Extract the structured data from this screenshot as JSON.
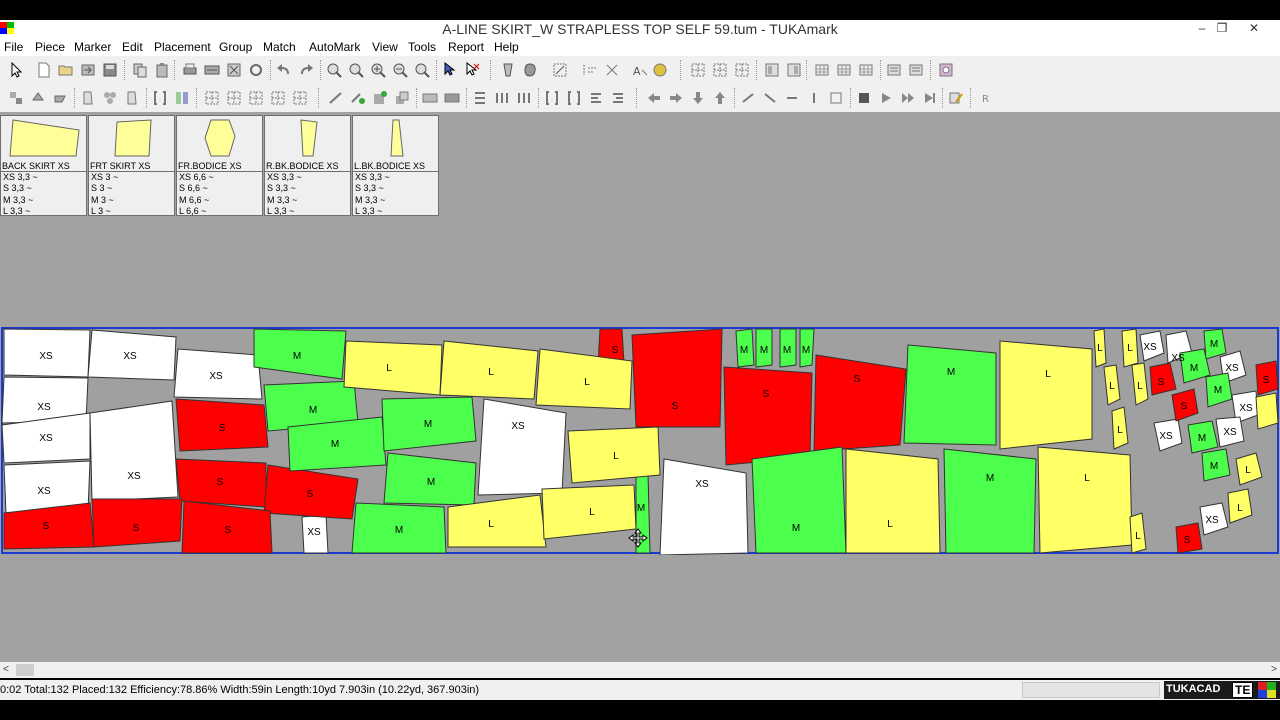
{
  "window": {
    "title": "A-LINE SKIRT_W STRAPLESS TOP SELF 59.tum - TUKAmark",
    "minimize_glyph": "–",
    "maximize_glyph": "❐",
    "close_glyph": "✕"
  },
  "menu": [
    "File",
    "Piece",
    "Marker",
    "Edit",
    "Placement",
    "Group",
    "Match",
    "AutoMark",
    "View",
    "Tools",
    "Report",
    "Help"
  ],
  "pieces": [
    {
      "name": "BACK SKIRT XS",
      "sizes": [
        "XS  3,3 ~",
        "S   3,3 ~",
        "M   3,3 ~",
        "L   3,3 ~"
      ]
    },
    {
      "name": "FRT SKIRT XS",
      "sizes": [
        "XS  3   ~",
        "S   3   ~",
        "M   3   ~",
        "L   3   ~"
      ]
    },
    {
      "name": "FR.BODICE XS",
      "sizes": [
        "XS  6,6 ~",
        "S   6,6 ~",
        "M   6,6 ~",
        "L   6,6 ~"
      ]
    },
    {
      "name": "R.BK.BODICE XS",
      "sizes": [
        "XS  3,3 ~",
        "S   3,3 ~",
        "M   3,3 ~",
        "L   3,3 ~"
      ]
    },
    {
      "name": "L.BK.BODICE XS",
      "sizes": [
        "XS  3,3 ~",
        "S   3,3 ~",
        "M   3,3 ~",
        "L   3,3 ~"
      ]
    }
  ],
  "size_colors": {
    "XS": "#ffffff",
    "S": "#ff0000",
    "M": "#4cff4c",
    "L": "#ffff66"
  },
  "marker_labels": [
    "XS",
    "XS",
    "XS",
    "XS",
    "XS",
    "XS",
    "XS",
    "XS",
    "XS",
    "XS",
    "XS",
    "XS",
    "XS",
    "XS",
    "XS",
    "XS",
    "XS",
    "S",
    "S",
    "S",
    "S",
    "S",
    "S",
    "S",
    "S",
    "S",
    "S",
    "S",
    "S",
    "S",
    "S",
    "M",
    "M",
    "M",
    "M",
    "M",
    "M",
    "M",
    "M",
    "M",
    "M",
    "M",
    "M",
    "M",
    "M",
    "M",
    "M",
    "M",
    "M",
    "M",
    "L",
    "L",
    "L",
    "L",
    "L",
    "L",
    "L",
    "L",
    "L",
    "L",
    "L",
    "L",
    "L",
    "L",
    "L",
    "L",
    "L",
    "L"
  ],
  "status": {
    "text": "0:02  Total:132  Placed:132  Efficiency:78.86%  Width:59in  Length:10yd 7.903in (10.22yd, 367.903in)",
    "logo": "TUKACAD",
    "logo_badge": "TE"
  },
  "scrollbar": {
    "left_glyph": "<",
    "right_glyph": ">"
  }
}
